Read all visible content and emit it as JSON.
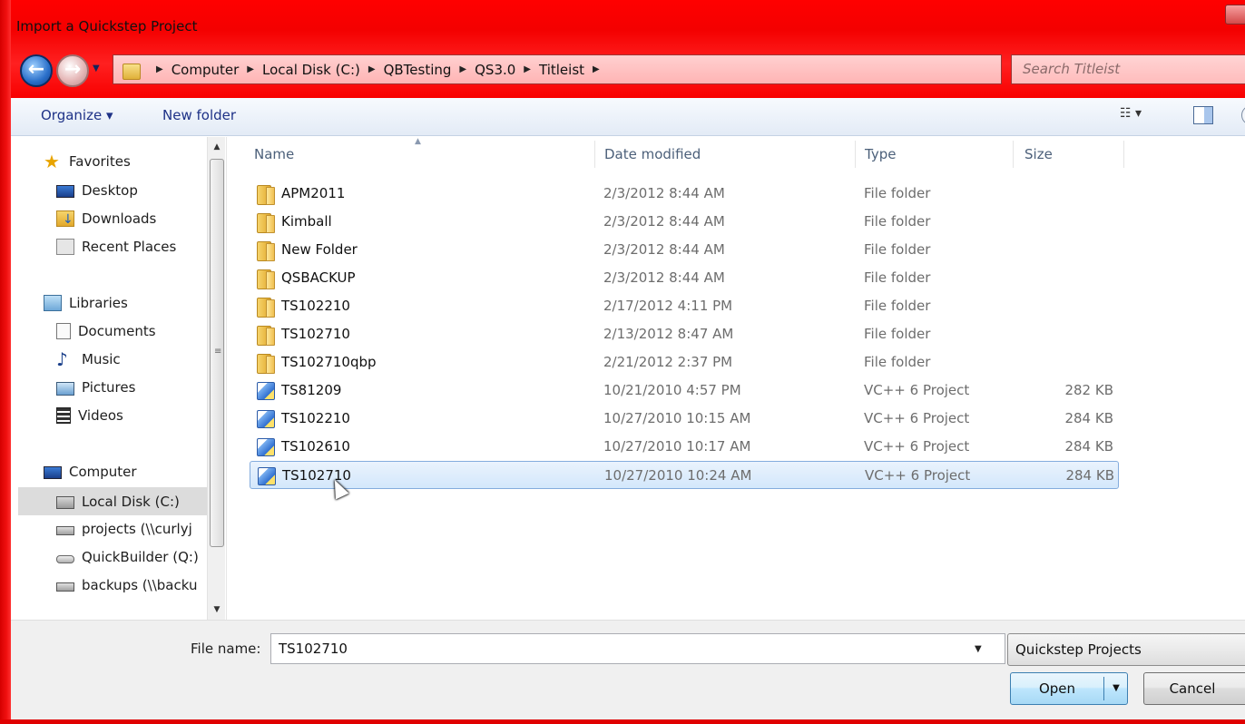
{
  "window": {
    "title": "Import a Quickstep Project"
  },
  "nav": {
    "breadcrumbs": [
      "Computer",
      "Local Disk (C:)",
      "QBTesting",
      "QS3.0",
      "Titleist"
    ],
    "search_placeholder": "Search Titleist"
  },
  "toolbar": {
    "organize": "Organize ▾",
    "new_folder": "New folder",
    "views_glyph": "☷ ▾"
  },
  "sidebar": {
    "favorites": "Favorites",
    "desktop": "Desktop",
    "downloads": "Downloads",
    "recent_places": "Recent Places",
    "libraries": "Libraries",
    "documents": "Documents",
    "music": "Music",
    "pictures": "Pictures",
    "videos": "Videos",
    "computer": "Computer",
    "local_disk": "Local Disk (C:)",
    "projects": "projects (\\\\curlyj",
    "quickbuilder": "QuickBuilder (Q:)",
    "backups": "backups (\\\\backu"
  },
  "columns": {
    "name": "Name",
    "date": "Date modified",
    "type": "Type",
    "size": "Size"
  },
  "files": [
    {
      "name": "APM2011",
      "date": "2/3/2012 8:44 AM",
      "type": "File folder",
      "size": "",
      "kind": "folder"
    },
    {
      "name": "Kimball",
      "date": "2/3/2012 8:44 AM",
      "type": "File folder",
      "size": "",
      "kind": "folder"
    },
    {
      "name": "New Folder",
      "date": "2/3/2012 8:44 AM",
      "type": "File folder",
      "size": "",
      "kind": "folder"
    },
    {
      "name": "QSBACKUP",
      "date": "2/3/2012 8:44 AM",
      "type": "File folder",
      "size": "",
      "kind": "folder"
    },
    {
      "name": "TS102210",
      "date": "2/17/2012 4:11 PM",
      "type": "File folder",
      "size": "",
      "kind": "folder"
    },
    {
      "name": "TS102710",
      "date": "2/13/2012 8:47 AM",
      "type": "File folder",
      "size": "",
      "kind": "folder"
    },
    {
      "name": "TS102710qbp",
      "date": "2/21/2012 2:37 PM",
      "type": "File folder",
      "size": "",
      "kind": "folder"
    },
    {
      "name": "TS81209",
      "date": "10/21/2010 4:57 PM",
      "type": "VC++ 6 Project",
      "size": "282 KB",
      "kind": "project"
    },
    {
      "name": "TS102210",
      "date": "10/27/2010 10:15 AM",
      "type": "VC++ 6 Project",
      "size": "284 KB",
      "kind": "project"
    },
    {
      "name": "TS102610",
      "date": "10/27/2010 10:17 AM",
      "type": "VC++ 6 Project",
      "size": "284 KB",
      "kind": "project"
    },
    {
      "name": "TS102710",
      "date": "10/27/2010 10:24 AM",
      "type": "VC++ 6 Project",
      "size": "284 KB",
      "kind": "project",
      "selected": true
    }
  ],
  "footer": {
    "file_name_label": "File name:",
    "file_name_value": "TS102710",
    "file_type": "Quickstep Projects",
    "open_label": "Open",
    "cancel_label": "Cancel"
  },
  "colors": {
    "frame": "#ff0000",
    "selection": "#d3e7fb",
    "link": "#1e3287"
  }
}
